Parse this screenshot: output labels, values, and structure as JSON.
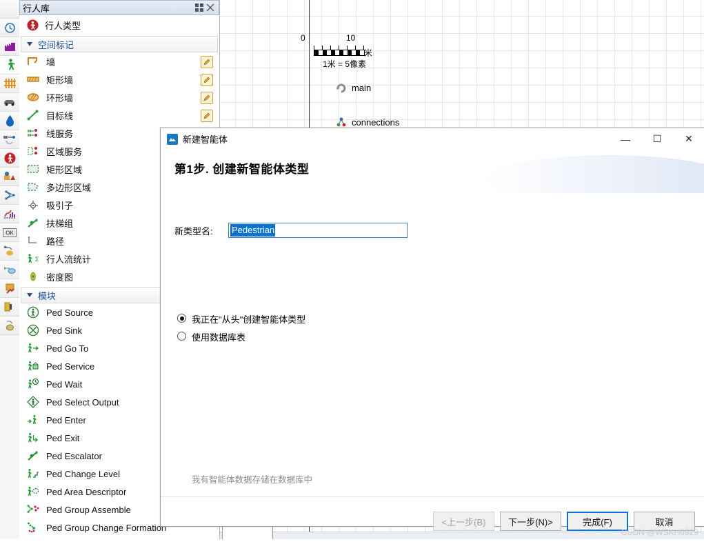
{
  "rail": {
    "items": [
      {
        "name": "blank-top",
        "icon": ""
      },
      {
        "name": "process-modeling-library",
        "icon": "clock"
      },
      {
        "name": "fluid-library",
        "icon": "factory"
      },
      {
        "name": "pedestrian-library",
        "icon": "pedestrian",
        "selected": true
      },
      {
        "name": "rail-library",
        "icon": "rails"
      },
      {
        "name": "road-traffic-library",
        "icon": "car"
      },
      {
        "name": "fluid-drop-library",
        "icon": "drop"
      },
      {
        "name": "material-handling-library",
        "icon": "conveyor"
      },
      {
        "name": "pedestrian-type-library",
        "icon": "ped-type"
      },
      {
        "name": "agent-library",
        "icon": "agent"
      },
      {
        "name": "network-library",
        "icon": "network"
      },
      {
        "name": "analysis-library",
        "icon": "chart"
      },
      {
        "name": "controls-library",
        "icon": "ok-button"
      },
      {
        "name": "connectivity-library",
        "icon": "db-link"
      },
      {
        "name": "data-library",
        "icon": "data-in"
      },
      {
        "name": "presentation-library",
        "icon": "presentation"
      },
      {
        "name": "3d-objects-library",
        "icon": "object3d"
      },
      {
        "name": "space-markup-library",
        "icon": "markup"
      }
    ]
  },
  "panel": {
    "title": "行人库",
    "pedestrian_type": "行人类型",
    "sections": [
      {
        "name": "space-markup",
        "label": "空间标记",
        "items": [
          {
            "label": "墙",
            "icon": "wall",
            "editable": true
          },
          {
            "label": "矩形墙",
            "icon": "rect-wall",
            "editable": true
          },
          {
            "label": "环形墙",
            "icon": "ring-wall",
            "editable": true
          },
          {
            "label": "目标线",
            "icon": "target-line",
            "editable": true
          },
          {
            "label": "线服务",
            "icon": "line-service",
            "editable": false
          },
          {
            "label": "区域服务",
            "icon": "area-service",
            "editable": false
          },
          {
            "label": "矩形区域",
            "icon": "rect-area",
            "editable": false
          },
          {
            "label": "多边形区域",
            "icon": "polygon-area",
            "editable": false
          },
          {
            "label": "吸引子",
            "icon": "attractor",
            "editable": false
          },
          {
            "label": "扶梯组",
            "icon": "escalator-group",
            "editable": false
          },
          {
            "label": "路径",
            "icon": "path",
            "editable": false
          },
          {
            "label": "行人流统计",
            "icon": "ped-flow-statistics",
            "editable": false
          },
          {
            "label": "密度图",
            "icon": "density-map",
            "editable": false
          }
        ]
      },
      {
        "name": "modules",
        "label": "模块",
        "items": [
          {
            "label": "Ped Source",
            "icon": "ped-source",
            "editable": false
          },
          {
            "label": "Ped Sink",
            "icon": "ped-sink",
            "editable": false
          },
          {
            "label": "Ped Go To",
            "icon": "ped-go-to",
            "editable": false
          },
          {
            "label": "Ped Service",
            "icon": "ped-service",
            "editable": false
          },
          {
            "label": "Ped Wait",
            "icon": "ped-wait",
            "editable": false
          },
          {
            "label": "Ped Select Output",
            "icon": "ped-select-output",
            "editable": false
          },
          {
            "label": "Ped Enter",
            "icon": "ped-enter",
            "editable": false
          },
          {
            "label": "Ped Exit",
            "icon": "ped-exit",
            "editable": false
          },
          {
            "label": "Ped Escalator",
            "icon": "ped-escalator",
            "editable": false
          },
          {
            "label": "Ped Change Level",
            "icon": "ped-change-level",
            "editable": false
          },
          {
            "label": "Ped Area Descriptor",
            "icon": "ped-area-descriptor",
            "editable": false
          },
          {
            "label": "Ped Group Assemble",
            "icon": "ped-group-assemble",
            "editable": false
          },
          {
            "label": "Ped Group Change Formation",
            "icon": "ped-group-change-formation",
            "editable": false
          }
        ]
      }
    ]
  },
  "canvas": {
    "ruler_start": "0",
    "ruler_end": "10",
    "ruler_unit": "米",
    "scale_text": "1米 = 5像素",
    "nodes": [
      {
        "label": "main",
        "icon": "main-agent"
      },
      {
        "label": "connections",
        "icon": "connections"
      }
    ]
  },
  "dialog": {
    "title": "新建智能体",
    "step_title": "第1步. 创建新智能体类型",
    "name_label": "新类型名:",
    "name_value": "Pedestrian",
    "options": [
      {
        "label": "我正在\"从头\"创建智能体类型",
        "selected": true
      },
      {
        "label": "使用数据库表",
        "selected": false
      }
    ],
    "hint": "我有智能体数据存储在数据库中",
    "window_buttons": {
      "minimize": "—",
      "maximize": "☐",
      "close": "✕"
    },
    "buttons": [
      {
        "label": "<上一步(B)",
        "state": "disabled",
        "name": "back-button"
      },
      {
        "label": "下一步(N)>",
        "state": "normal",
        "name": "next-button"
      },
      {
        "label": "完成(F)",
        "state": "default",
        "name": "finish-button"
      },
      {
        "label": "取消",
        "state": "normal",
        "name": "cancel-button"
      }
    ]
  },
  "watermark": "CSDN @WSKH0929"
}
